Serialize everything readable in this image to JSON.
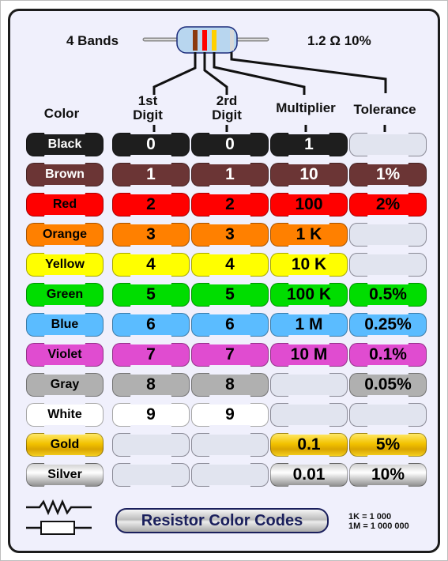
{
  "header": {
    "bands_label": "4 Bands",
    "example_value": "1.2 Ω 10%",
    "example_bands": [
      "#8b3a0e",
      "#ff0000",
      "#ffd000",
      "#d8d8d8"
    ],
    "resistor_body_color": "#b8d6ef"
  },
  "columns": {
    "color": "Color",
    "digit1_line1": "1st",
    "digit1_line2": "Digit",
    "digit2_line1": "2rd",
    "digit2_line2": "Digit",
    "multiplier": "Multiplier",
    "tolerance": "Tolerance"
  },
  "rows": [
    {
      "name": "Black",
      "digit1": "0",
      "digit2": "0",
      "multiplier": "1",
      "tolerance": "",
      "bg": "#1e1e1e",
      "fg": "#ffffff"
    },
    {
      "name": "Brown",
      "digit1": "1",
      "digit2": "1",
      "multiplier": "10",
      "tolerance": "1%",
      "bg": "#6b3535",
      "fg": "#ffffff"
    },
    {
      "name": "Red",
      "digit1": "2",
      "digit2": "2",
      "multiplier": "100",
      "tolerance": "2%",
      "bg": "#ff0000",
      "fg": "#000000"
    },
    {
      "name": "Orange",
      "digit1": "3",
      "digit2": "3",
      "multiplier": "1 K",
      "tolerance": "",
      "bg": "#ff8000",
      "fg": "#000000"
    },
    {
      "name": "Yellow",
      "digit1": "4",
      "digit2": "4",
      "multiplier": "10 K",
      "tolerance": "",
      "bg": "#ffff00",
      "fg": "#000000"
    },
    {
      "name": "Green",
      "digit1": "5",
      "digit2": "5",
      "multiplier": "100 K",
      "tolerance": "0.5%",
      "bg": "#00dd00",
      "fg": "#000000"
    },
    {
      "name": "Blue",
      "digit1": "6",
      "digit2": "6",
      "multiplier": "1 M",
      "tolerance": "0.25%",
      "bg": "#5bbcff",
      "fg": "#000000"
    },
    {
      "name": "Violet",
      "digit1": "7",
      "digit2": "7",
      "multiplier": "10 M",
      "tolerance": "0.1%",
      "bg": "#e04cd0",
      "fg": "#000000"
    },
    {
      "name": "Gray",
      "digit1": "8",
      "digit2": "8",
      "multiplier": "",
      "tolerance": "0.05%",
      "bg": "#b0b0b0",
      "fg": "#000000"
    },
    {
      "name": "White",
      "digit1": "9",
      "digit2": "9",
      "multiplier": "",
      "tolerance": "",
      "bg": "#ffffff",
      "fg": "#000000"
    },
    {
      "name": "Gold",
      "digit1": "",
      "digit2": "",
      "multiplier": "0.1",
      "tolerance": "5%",
      "bg": "linear-gradient(#ffe866,#f2c200 45%,#d9a400 70%,#f5cf20)",
      "fg": "#000000"
    },
    {
      "name": "Silver",
      "digit1": "",
      "digit2": "",
      "multiplier": "0.01",
      "tolerance": "10%",
      "bg": "linear-gradient(#cfcfcf,#ffffff 40%,#bdbdbd 75%,#8f8f8f)",
      "fg": "#000000"
    }
  ],
  "footer": {
    "title": "Resistor Color Codes",
    "note_k": "1K = 1 000",
    "note_m": "1M = 1 000 000"
  }
}
